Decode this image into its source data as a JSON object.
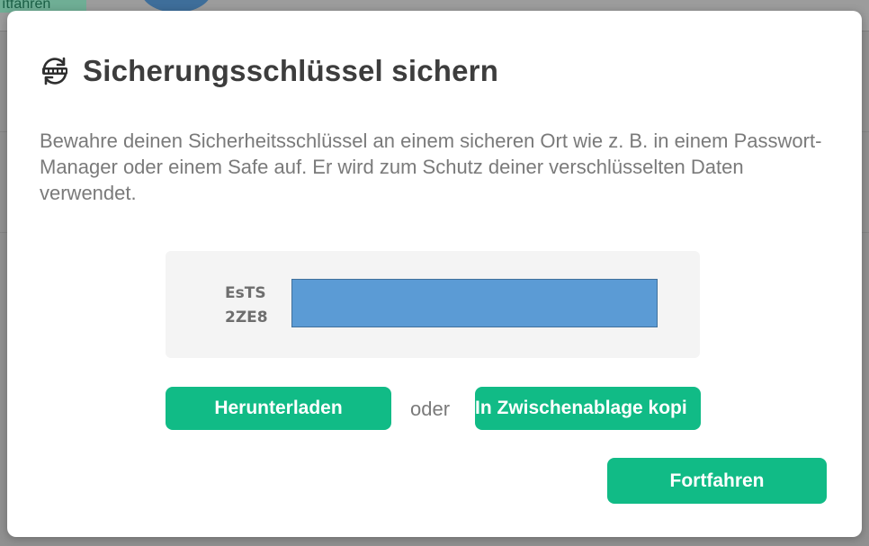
{
  "background": {
    "chip_label": "ıtfahren"
  },
  "dialog": {
    "title": "Sicherungsschlüssel sichern",
    "title_icon": "key-sync-icon",
    "description": "Bewahre deinen Sicherheitsschlüssel an einem sicheren Ort wie z. B. in einem Passwort-Manager oder einem Safe auf. Er wird zum Schutz deiner verschlüsselten Daten verwendet.",
    "key": {
      "line1": "EsTS",
      "line2": "2ZE8"
    },
    "download_label": "Herunterladen",
    "or_label": "oder",
    "copy_label": "In Zwischenablage kopi",
    "continue_label": "Fortfahren"
  },
  "colors": {
    "accent": "#11bb86",
    "title": "#3d3d3d",
    "muted_text": "#7a7a7a",
    "key_box": "#f4f4f4",
    "redaction": "#5b9bd5"
  }
}
